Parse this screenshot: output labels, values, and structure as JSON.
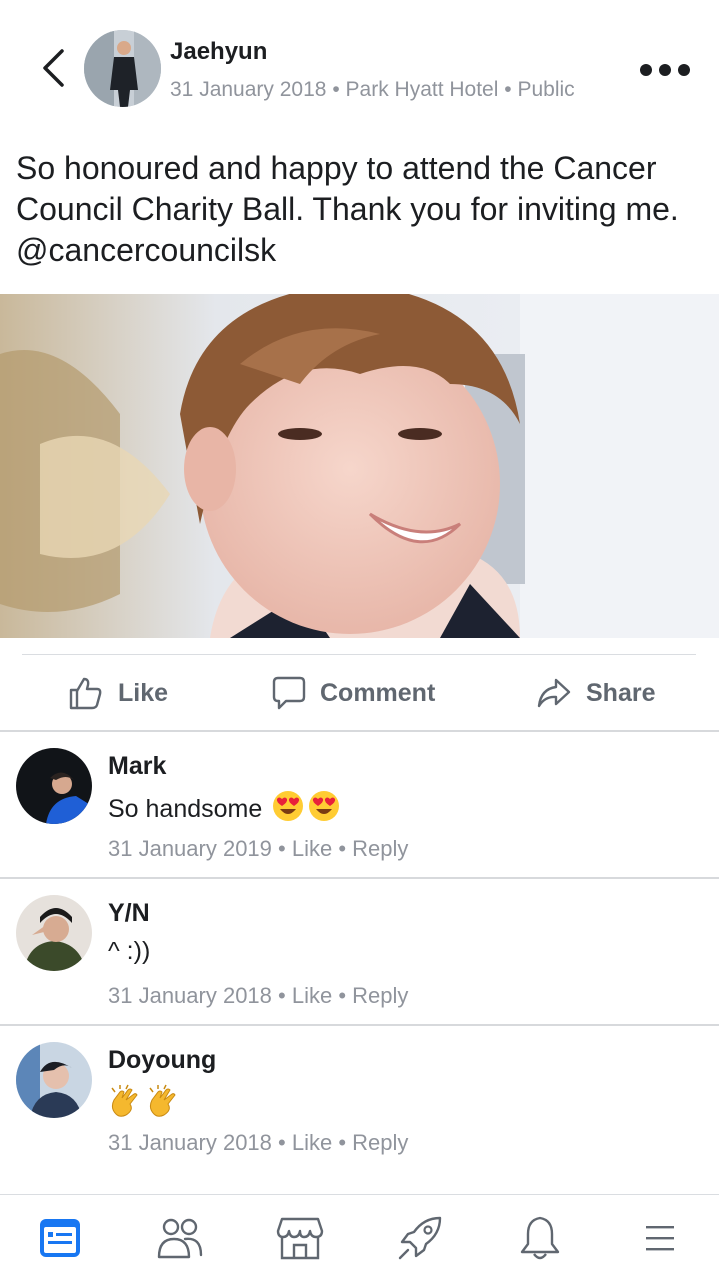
{
  "post": {
    "author": "Jaehyun",
    "date": "31 January 2018",
    "location": "Park Hyatt Hotel",
    "audience": "Public",
    "text": "So honoured and happy to attend the Cancer Council Charity Ball. Thank you for inviting me. @cancercouncilsk"
  },
  "actions": {
    "like": "Like",
    "comment": "Comment",
    "share": "Share"
  },
  "comments": [
    {
      "name": "Mark",
      "text": "So handsome",
      "emoji": [
        "heart-eyes-emoji",
        "heart-eyes-emoji"
      ],
      "date": "31 January 2019",
      "like": "Like",
      "reply": "Reply"
    },
    {
      "name": "Y/N",
      "text": "^ :))",
      "emoji": [],
      "date": "31 January 2018",
      "like": "Like",
      "reply": "Reply"
    },
    {
      "name": "Doyoung",
      "text": "",
      "emoji": [
        "clapping-hands-emoji",
        "clapping-hands-emoji"
      ],
      "date": "31 January 2018",
      "like": "Like",
      "reply": "Reply"
    }
  ],
  "separator": "•",
  "colors": {
    "primary_text": "#1c1e21",
    "secondary_text": "#90949c",
    "action_text": "#606770",
    "active_nav": "#1877f2",
    "divider": "#dadde1"
  },
  "nav_icons": [
    "news-feed-icon",
    "friends-icon",
    "marketplace-icon",
    "rocket-icon",
    "notifications-icon",
    "menu-icon"
  ]
}
